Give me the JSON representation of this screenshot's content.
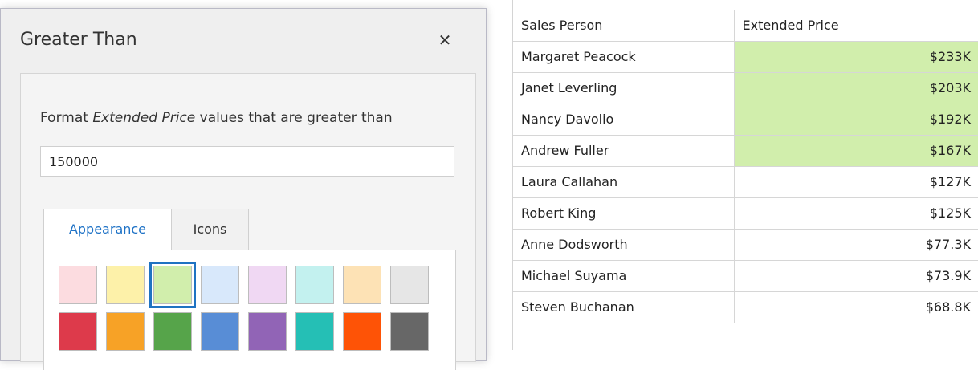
{
  "dialog": {
    "title": "Greater Than",
    "close_glyph": "✕",
    "prompt_prefix": "Format ",
    "prompt_field": "Extended Price",
    "prompt_suffix": " values that are greater than",
    "input_value": "150000",
    "tabs": [
      {
        "label": "Appearance",
        "active": true
      },
      {
        "label": "Icons",
        "active": false
      }
    ],
    "swatches": [
      {
        "name": "pale-red",
        "color": "#fcdce0"
      },
      {
        "name": "pale-yellow",
        "color": "#fdf1a9"
      },
      {
        "name": "pale-green",
        "color": "#d1eeac",
        "selected": true
      },
      {
        "name": "pale-blue",
        "color": "#d8e8fb"
      },
      {
        "name": "pale-purple",
        "color": "#f0d8f3"
      },
      {
        "name": "pale-cyan",
        "color": "#c3f1ef"
      },
      {
        "name": "pale-orange",
        "color": "#fde2b5"
      },
      {
        "name": "pale-gray",
        "color": "#e6e6e6"
      },
      {
        "name": "red",
        "color": "#dd3a4b"
      },
      {
        "name": "orange",
        "color": "#f7a226"
      },
      {
        "name": "green",
        "color": "#56a44a"
      },
      {
        "name": "blue",
        "color": "#588dd6"
      },
      {
        "name": "purple",
        "color": "#9164b6"
      },
      {
        "name": "teal",
        "color": "#25bfb5"
      },
      {
        "name": "deep-orange",
        "color": "#fe5306"
      },
      {
        "name": "gray",
        "color": "#676767"
      }
    ]
  },
  "grid": {
    "columns": [
      "Sales Person",
      "Extended Price"
    ],
    "highlight_color": "#d1eeac",
    "rows": [
      {
        "name": "Margaret Peacock",
        "price": "$233K",
        "highlighted": true
      },
      {
        "name": "Janet Leverling",
        "price": "$203K",
        "highlighted": true
      },
      {
        "name": "Nancy Davolio",
        "price": "$192K",
        "highlighted": true
      },
      {
        "name": "Andrew Fuller",
        "price": "$167K",
        "highlighted": true
      },
      {
        "name": "Laura Callahan",
        "price": "$127K",
        "highlighted": false
      },
      {
        "name": "Robert King",
        "price": "$125K",
        "highlighted": false
      },
      {
        "name": "Anne Dodsworth",
        "price": "$77.3K",
        "highlighted": false
      },
      {
        "name": "Michael Suyama",
        "price": "$73.9K",
        "highlighted": false
      },
      {
        "name": "Steven Buchanan",
        "price": "$68.8K",
        "highlighted": false
      }
    ]
  }
}
